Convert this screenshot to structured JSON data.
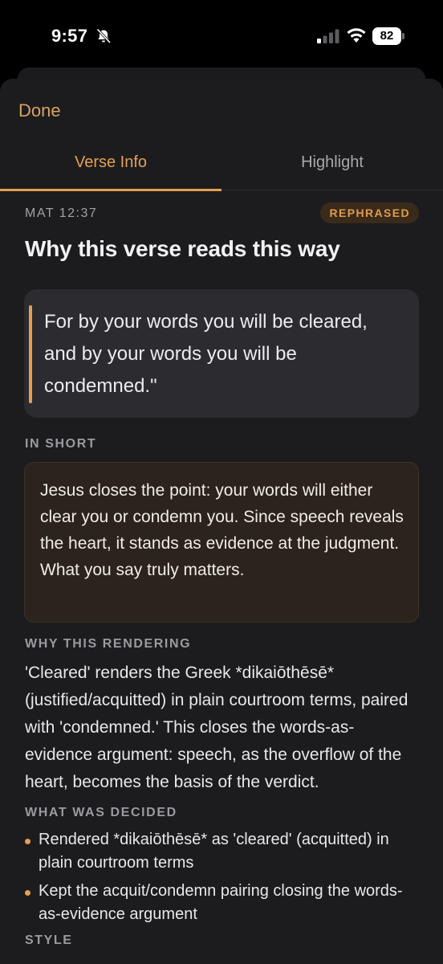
{
  "status_bar": {
    "time": "9:57",
    "battery": "82"
  },
  "sheet": {
    "done_label": "Done",
    "tabs": [
      {
        "label": "Verse Info",
        "active": true
      },
      {
        "label": "Highlight",
        "active": false
      }
    ]
  },
  "verse": {
    "reference": "MAT 12:37",
    "badge": "REPHRASED",
    "title": "Why this verse reads this way",
    "text": "For by your words you will be cleared, and by your words you will be condemned.\""
  },
  "in_short": {
    "label": "IN SHORT",
    "text": "Jesus closes the point: your words will either clear you or condemn you. Since speech reveals the heart, it stands as evidence at the judgment. What you say truly matters."
  },
  "why_rendering": {
    "label": "WHY THIS RENDERING",
    "text": "'Cleared' renders the Greek *dikaiōthēsē* (justified/acquitted) in plain courtroom terms, paired with 'condemned.' This closes the words-as-evidence argument: speech, as the overflow of the heart, becomes the basis of the verdict."
  },
  "decided": {
    "label": "WHAT WAS DECIDED",
    "items": [
      "Rendered *dikaiōthēsē* as 'cleared' (acquitted) in plain courtroom terms",
      "Kept the acquit/condemn pairing closing the words-as-evidence argument"
    ]
  },
  "style": {
    "label": "STYLE"
  },
  "colors": {
    "accent": "#e59f52",
    "background": "#1c1c1e",
    "card": "#2c2c30",
    "summary_card": "#2b231c"
  }
}
